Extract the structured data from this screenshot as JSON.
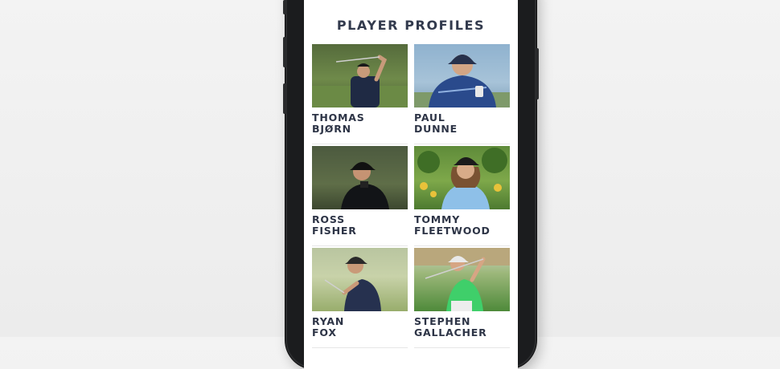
{
  "page": {
    "title": "PLAYER PROFILES"
  },
  "players": [
    {
      "first": "THOMAS",
      "last": "BJØRN"
    },
    {
      "first": "PAUL",
      "last": "DUNNE"
    },
    {
      "first": "ROSS",
      "last": "FISHER"
    },
    {
      "first": "TOMMY",
      "last": "FLEETWOOD"
    },
    {
      "first": "RYAN",
      "last": "FOX"
    },
    {
      "first": "STEPHEN",
      "last": "GALLACHER"
    }
  ],
  "colors": {
    "title_text": "#323a4d",
    "name_text": "#2d3446",
    "phone_body": "#1b1c1e"
  }
}
